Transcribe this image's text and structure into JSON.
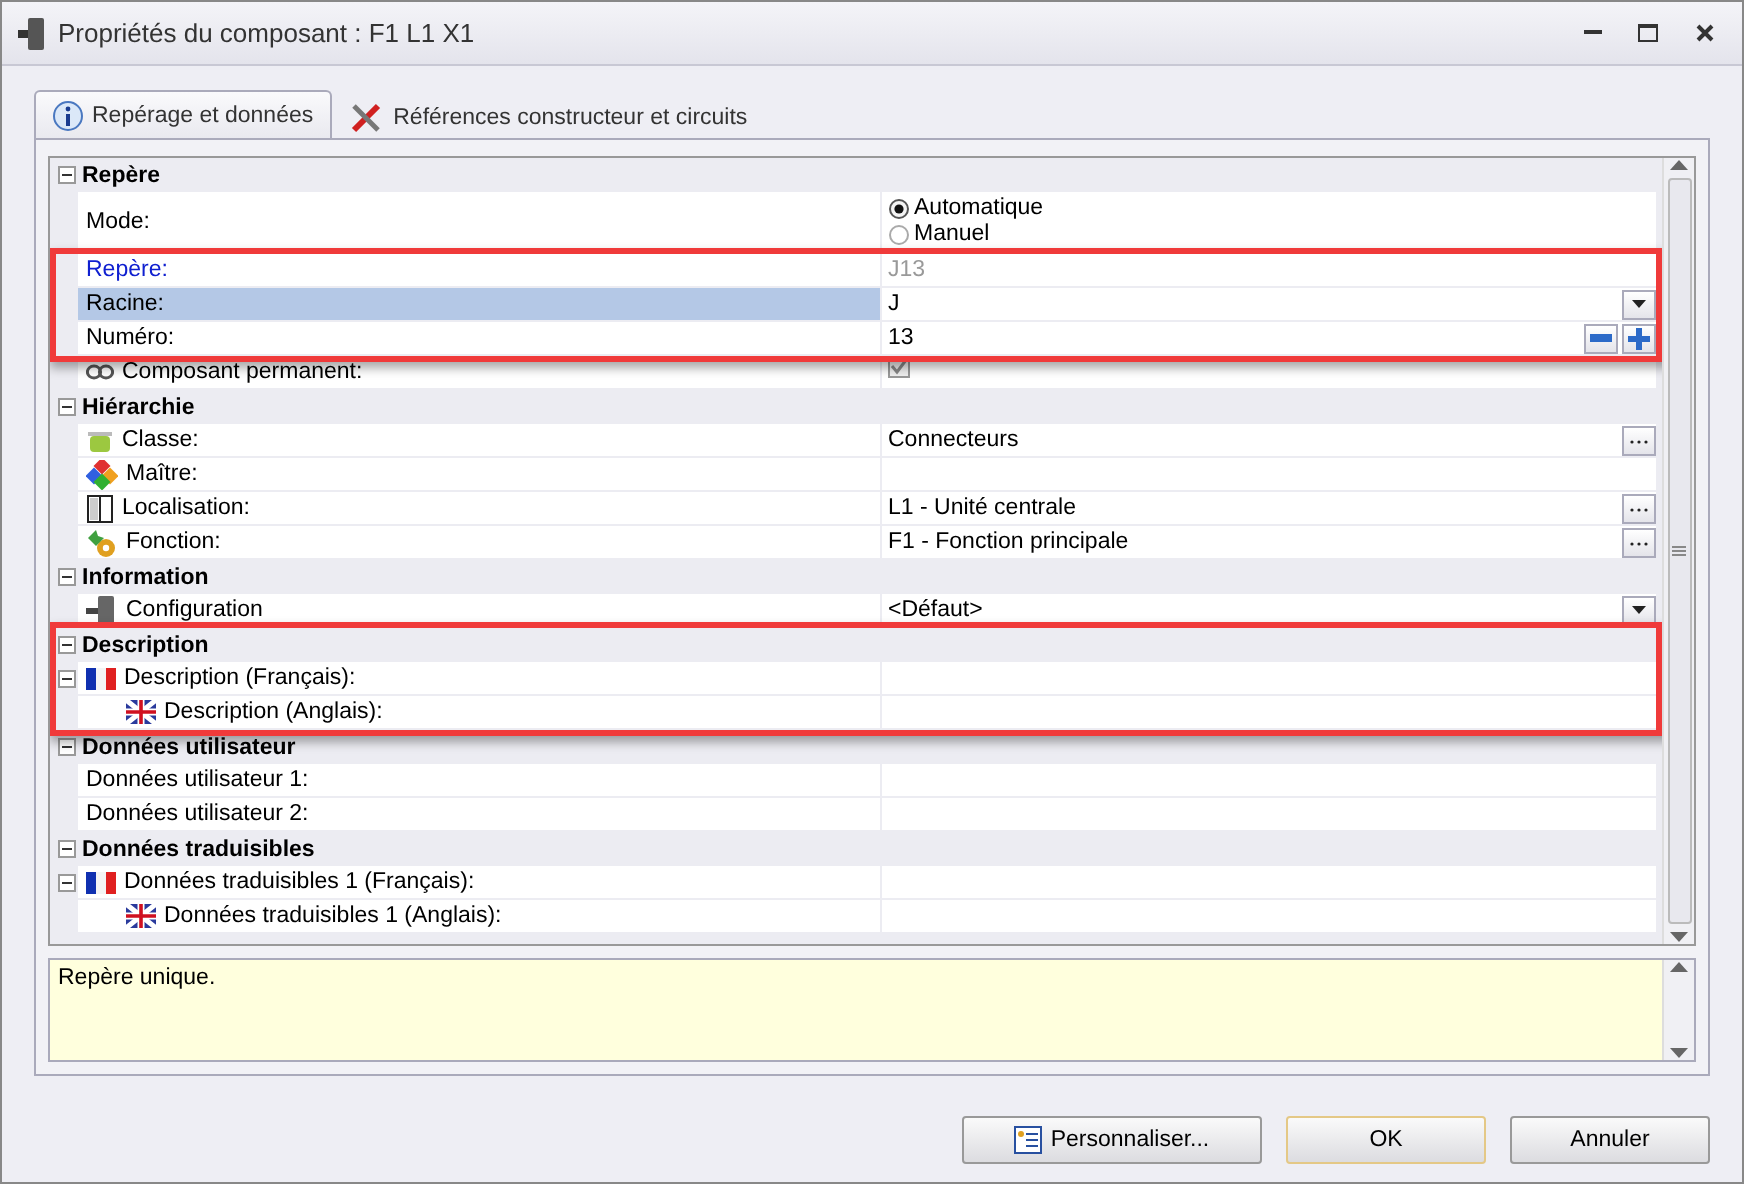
{
  "window": {
    "title": "Propriétés du composant : F1 L1 X1"
  },
  "tabs": [
    {
      "label": "Repérage et données",
      "selected": true
    },
    {
      "label": "Références constructeur et circuits",
      "selected": false
    }
  ],
  "sections": [
    {
      "title": "Repère",
      "expanded": true,
      "highlighted": false,
      "rows": [
        {
          "kind": "radio",
          "label": "Mode:",
          "highlighted": false,
          "options": [
            {
              "label": "Automatique",
              "selected": true
            },
            {
              "label": "Manuel",
              "selected": false
            }
          ]
        },
        {
          "kind": "readonly",
          "label": "Repère:",
          "value": "J13",
          "highlighted": true,
          "selected": false
        },
        {
          "kind": "dropdown",
          "label": "Racine:",
          "value": "J",
          "highlighted": true,
          "selected": true
        },
        {
          "kind": "spin",
          "label": "Numéro:",
          "value": "13",
          "highlighted": true,
          "selected": false
        },
        {
          "kind": "checkbox",
          "label": "Composant permanent:",
          "checked": true,
          "highlighted": false,
          "selected": false
        }
      ]
    },
    {
      "title": "Hiérarchie",
      "expanded": true,
      "highlighted": false,
      "rows": [
        {
          "kind": "browse",
          "label": "Classe:",
          "value": "Connecteurs",
          "highlighted": false,
          "selected": false
        },
        {
          "kind": "text",
          "label": "Maître:",
          "highlighted": false,
          "selected": false
        },
        {
          "kind": "browse",
          "label": "Localisation:",
          "value": "L1 - Unité centrale",
          "highlighted": false,
          "selected": false
        },
        {
          "kind": "browse",
          "label": "Fonction:",
          "value": "F1 - Fonction principale",
          "highlighted": false,
          "selected": false
        }
      ]
    },
    {
      "title": "Information",
      "expanded": true,
      "highlighted": false,
      "rows": [
        {
          "kind": "dropdown",
          "label": "Configuration",
          "value": "<Défaut>",
          "highlighted": false,
          "selected": false
        }
      ]
    },
    {
      "title": "Description",
      "expanded": true,
      "highlighted": true,
      "rows": [
        {
          "kind": "text",
          "label": "Description (Français):",
          "highlighted": true,
          "selected": false,
          "expanded": true,
          "children": [
            {
              "kind": "text",
              "label": "Description (Anglais):",
              "highlighted": true,
              "selected": false
            }
          ]
        }
      ]
    },
    {
      "title": "Données utilisateur",
      "expanded": true,
      "highlighted": false,
      "rows": [
        {
          "kind": "text",
          "label": "Données utilisateur 1:",
          "highlighted": false,
          "selected": false
        },
        {
          "kind": "text",
          "label": "Données utilisateur 2:",
          "highlighted": false,
          "selected": false
        }
      ]
    },
    {
      "title": "Données traduisibles",
      "expanded": true,
      "highlighted": false,
      "rows": [
        {
          "kind": "text",
          "label": "Données traduisibles 1 (Français):",
          "highlighted": false,
          "selected": false,
          "expanded": true,
          "children": [
            {
              "kind": "text",
              "label": "Données traduisibles 1 (Anglais):",
              "highlighted": false,
              "selected": false
            }
          ]
        }
      ]
    }
  ],
  "help": {
    "text": "Repère unique."
  },
  "buttons": [
    {
      "label": "Personnaliser...",
      "kind": "icon",
      "default": false
    },
    {
      "label": "OK",
      "kind": "plain",
      "default": true
    },
    {
      "label": "Annuler",
      "kind": "plain",
      "default": false
    }
  ]
}
